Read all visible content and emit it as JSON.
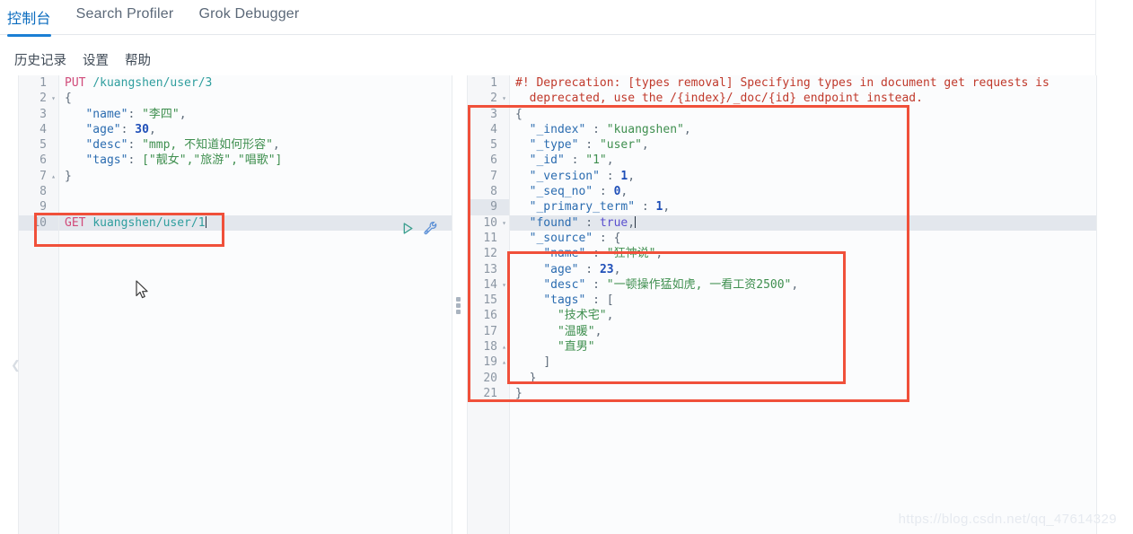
{
  "topbar": {
    "tabs": [
      {
        "label": "控制台",
        "active": true
      },
      {
        "label": "Search Profiler",
        "active": false
      },
      {
        "label": "Grok Debugger",
        "active": false
      }
    ]
  },
  "menubar": {
    "items": [
      {
        "label": "历史记录"
      },
      {
        "label": "设置"
      },
      {
        "label": "帮助"
      }
    ]
  },
  "editor": {
    "gutter": [
      {
        "n": "1",
        "fold": ""
      },
      {
        "n": "2",
        "fold": "▾"
      },
      {
        "n": "3",
        "fold": ""
      },
      {
        "n": "4",
        "fold": ""
      },
      {
        "n": "5",
        "fold": ""
      },
      {
        "n": "6",
        "fold": ""
      },
      {
        "n": "7",
        "fold": "▴"
      },
      {
        "n": "8",
        "fold": ""
      },
      {
        "n": "9",
        "fold": ""
      },
      {
        "n": "10",
        "fold": ""
      }
    ],
    "lines": [
      {
        "method": "PUT",
        "url": "/kuangshen/user/3"
      },
      {
        "text": "{"
      },
      {
        "key": "\"name\"",
        "sep": ": ",
        "val": "\"李四\"",
        "tail": ","
      },
      {
        "key": "\"age\"",
        "sep": ": ",
        "num": "30",
        "tail": ","
      },
      {
        "key": "\"desc\"",
        "sep": ": ",
        "val": "\"mmp, 不知道如何形容\"",
        "tail": ","
      },
      {
        "key": "\"tags\"",
        "sep": ": ",
        "val": "[\"靓女\",\"旅游\",\"唱歌\"]"
      },
      {
        "text": "}"
      },
      {
        "text": ""
      },
      {
        "text": ""
      },
      {
        "method": "GET",
        "url": "kuangshen/user/1"
      }
    ],
    "actions": {
      "run_label": "play-button",
      "wrench_label": "wrench-button"
    }
  },
  "output": {
    "gutter": [
      {
        "n": "1",
        "fold": ""
      },
      {
        "n": "2",
        "fold": "▾"
      },
      {
        "n": "3",
        "fold": ""
      },
      {
        "n": "4",
        "fold": ""
      },
      {
        "n": "5",
        "fold": ""
      },
      {
        "n": "6",
        "fold": ""
      },
      {
        "n": "7",
        "fold": ""
      },
      {
        "n": "8",
        "fold": ""
      },
      {
        "n": "9",
        "fold": ""
      },
      {
        "n": "10",
        "fold": "▾"
      },
      {
        "n": "11",
        "fold": ""
      },
      {
        "n": "12",
        "fold": ""
      },
      {
        "n": "13",
        "fold": ""
      },
      {
        "n": "14",
        "fold": "▾"
      },
      {
        "n": "15",
        "fold": ""
      },
      {
        "n": "16",
        "fold": ""
      },
      {
        "n": "17",
        "fold": ""
      },
      {
        "n": "18",
        "fold": "▴"
      },
      {
        "n": "19",
        "fold": "▴"
      },
      {
        "n": "20",
        "fold": ""
      },
      {
        "n": "21",
        "fold": ""
      }
    ],
    "warning_line_1": "#! Deprecation: [types removal] Specifying types in document get requests is",
    "warning_line_2": "deprecated, use the /{index}/_doc/{id} endpoint instead.",
    "body": [
      {
        "text": "{"
      },
      {
        "key": "\"_index\"",
        "sep": " : ",
        "str": "\"kuangshen\"",
        "tail": ","
      },
      {
        "key": "\"_type\"",
        "sep": " : ",
        "str": "\"user\"",
        "tail": ","
      },
      {
        "key": "\"_id\"",
        "sep": " : ",
        "str": "\"1\"",
        "tail": ","
      },
      {
        "key": "\"_version\"",
        "sep": " : ",
        "num": "1",
        "tail": ","
      },
      {
        "key": "\"_seq_no\"",
        "sep": " : ",
        "num": "0",
        "tail": ","
      },
      {
        "key": "\"_primary_term\"",
        "sep": " : ",
        "num": "1",
        "tail": ","
      },
      {
        "key": "\"found\"",
        "sep": " : ",
        "bool": "true",
        "tail": ","
      },
      {
        "key": "\"_source\"",
        "sep": " : ",
        "plain": "{"
      },
      {
        "key": "\"name\"",
        "sep": " : ",
        "str": "\"狂神说\"",
        "tail": ","
      },
      {
        "key": "\"age\"",
        "sep": " : ",
        "num": "23",
        "tail": ","
      },
      {
        "key": "\"desc\"",
        "sep": " : ",
        "str": "\"一顿操作猛如虎, 一看工资2500\"",
        "tail": ","
      },
      {
        "key": "\"tags\"",
        "sep": " : ",
        "plain": "["
      },
      {
        "str": "\"技术宅\"",
        "tail": ","
      },
      {
        "str": "\"温暖\"",
        "tail": ","
      },
      {
        "str": "\"直男\""
      },
      {
        "plain": "]"
      },
      {
        "plain": "}"
      },
      {
        "plain": "}"
      },
      {
        "plain": ""
      }
    ]
  },
  "annotations": {
    "request_box": "red-highlight-request",
    "response_box": "red-highlight-response",
    "source_box": "red-highlight-source"
  },
  "watermark": "https://blog.csdn.net/qq_47614329",
  "colors": {
    "accent": "#1b7fd4",
    "annotation": "#f0503a",
    "string": "#3f8f4f",
    "key": "#2b6cb0",
    "method": "#d14b7a",
    "warning": "#c0392b"
  }
}
